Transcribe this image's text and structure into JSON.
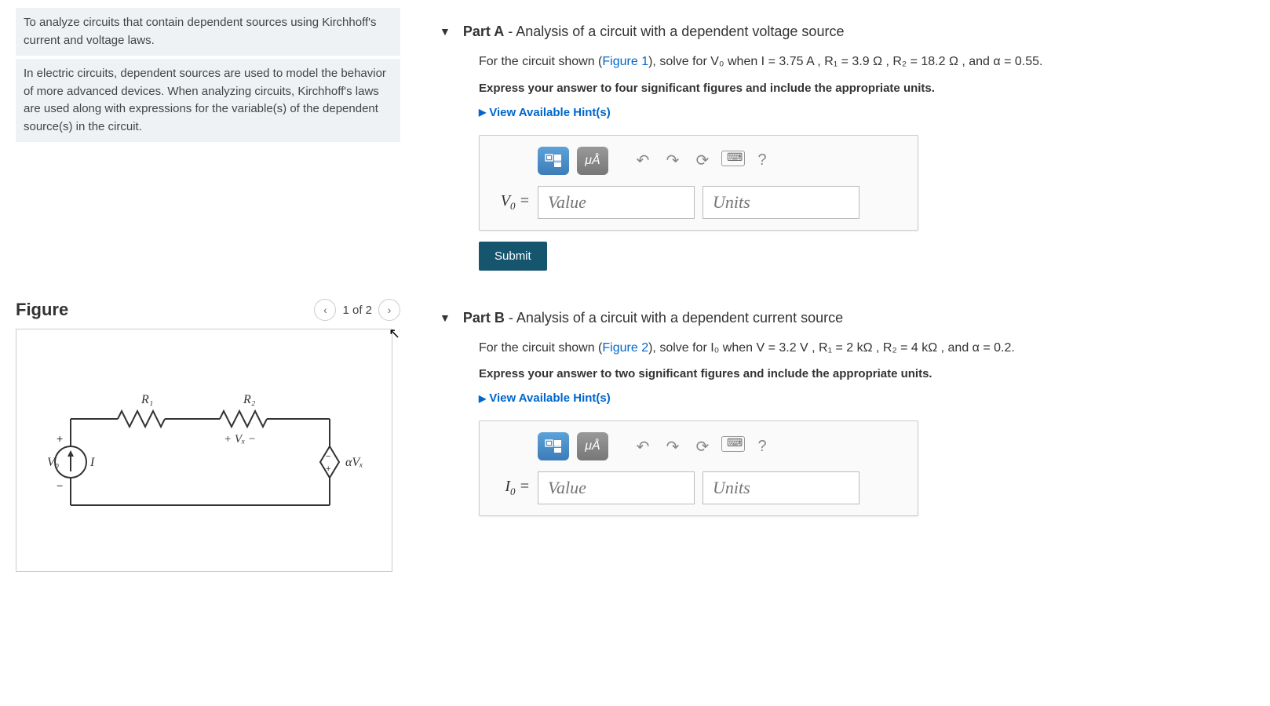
{
  "left": {
    "intro1": "To analyze circuits that contain dependent sources using Kirchhoff's current and voltage laws.",
    "intro2": "In electric circuits, dependent sources are used to model the behavior of more advanced devices. When analyzing circuits, Kirchhoff's laws are used along with expressions for the variable(s) of the dependent source(s) in the circuit."
  },
  "figure": {
    "title": "Figure",
    "nav_text": "1 of 2",
    "labels": {
      "r1": "R₁",
      "r2": "R₂",
      "vx": "+ Vₓ −",
      "v0": "V₀",
      "i": "I",
      "aVx": "αVₓ"
    }
  },
  "partA": {
    "header_bold": "Part A",
    "header_rest": " - Analysis of a circuit with a dependent voltage source",
    "text_pre": "For the circuit shown (",
    "fig_link": "Figure 1",
    "text_post": "), solve for V₀ when I = 3.75 A , R₁ = 3.9 Ω , R₂ = 18.2 Ω , and α = 0.55.",
    "instr": "Express your answer to four significant figures and include the appropriate units.",
    "hints": "View Available Hint(s)",
    "var_html": "V₀ =",
    "val_placeholder": "Value",
    "units_placeholder": "Units",
    "toolbar_symb": "μÅ",
    "submit": "Submit"
  },
  "partB": {
    "header_bold": "Part B",
    "header_rest": " - Analysis of a circuit with a dependent current source",
    "text_pre": "For the circuit shown (",
    "fig_link": "Figure 2",
    "text_post": "), solve for I₀ when V = 3.2 V , R₁ = 2 kΩ , R₂ = 4 kΩ , and α = 0.2.",
    "instr": "Express your answer to two significant figures and include the appropriate units.",
    "hints": "View Available Hint(s)",
    "var_html": "I₀ =",
    "val_placeholder": "Value",
    "units_placeholder": "Units",
    "toolbar_symb": "μÅ"
  }
}
